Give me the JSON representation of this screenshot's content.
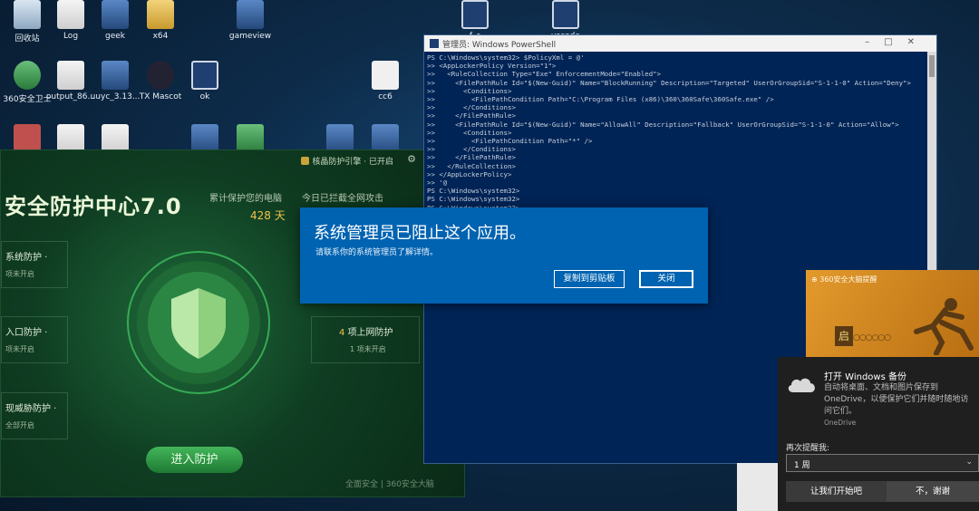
{
  "desktop": {
    "icons": [
      {
        "label": "回收站",
        "icon": "recycle-bin-icon"
      },
      {
        "label": "Log",
        "icon": "file-icon"
      },
      {
        "label": "geek",
        "icon": "app-icon"
      },
      {
        "label": "x64",
        "icon": "folder-icon"
      },
      {
        "label": "gameview",
        "icon": "app-icon"
      },
      {
        "label": "f_s",
        "icon": "window-app-icon"
      },
      {
        "label": "vscode",
        "icon": "window-app-icon"
      },
      {
        "label": "360安全卫士",
        "icon": "shield-plus-icon"
      },
      {
        "label": "output_86...",
        "icon": "file-icon"
      },
      {
        "label": "uuyc_3.13...",
        "icon": "app-icon"
      },
      {
        "label": "TX Mascot",
        "icon": "cat-icon"
      },
      {
        "label": "ok",
        "icon": "window-app-icon"
      },
      {
        "label": "cc6",
        "icon": "cc-app-icon"
      }
    ]
  },
  "security_window": {
    "guard_label": "核晶防护引擎 · 已开启",
    "title": "安全防护中心7.0",
    "stat1_label": "累计保护您的电脑",
    "stat1_value": "428 天",
    "stat2_label": "今日已拦截全网攻击",
    "modules": [
      {
        "name": "系统防护 ·",
        "status": "项未开启"
      },
      {
        "name": "入口防护 ·",
        "status": "项未开启"
      },
      {
        "name": "现威胁防护 ·",
        "status": "全部开启"
      }
    ],
    "right_module": {
      "count": "4",
      "name": "项上网防护",
      "status": "1 项未开启"
    },
    "enter_button": "进入防护",
    "footer": "全面安全  |  360安全大脑"
  },
  "powershell": {
    "title": "管理员: Windows PowerShell",
    "lines": [
      "PS C:\\Windows\\system32> $PolicyXml = @'",
      ">> <AppLockerPolicy Version=\"1\">",
      ">>   <RuleCollection Type=\"Exe\" EnforcementMode=\"Enabled\">",
      ">>     <FilePathRule Id=\"$(New-Guid)\" Name=\"BlockRunning\" Description=\"Targeted\" UserOrGroupSid=\"S-1-1-0\" Action=\"Deny\">",
      ">>       <Conditions>",
      ">>         <FilePathCondition Path=\"C:\\Program Files (x86)\\360\\360Safe\\360Safe.exe\" />",
      ">>       </Conditions>",
      ">>     </FilePathRule>",
      ">>     <FilePathRule Id=\"$(New-Guid)\" Name=\"AllowAll\" Description=\"Fallback\" UserOrGroupSid=\"S-1-1-0\" Action=\"Allow\">",
      ">>       <Conditions>",
      ">>         <FilePathCondition Path=\"*\" />",
      ">>       </Conditions>",
      ">>     </FilePathRule>",
      ">>   </RuleCollection>",
      ">> </AppLockerPolicy>",
      ">> '@",
      "PS C:\\Windows\\system32>",
      "PS C:\\Windows\\system32>",
      "PS C:\\Windows\\system32> "
    ]
  },
  "blocked_dialog": {
    "heading": "系统管理员已阻止这个应用。",
    "message": "请联系你的系统管理员了解详情。",
    "copy_button": "复制到剪贴板",
    "close_button": "关闭"
  },
  "ad_popup": {
    "title": "360安全大脑提醒",
    "box_glyph": "启"
  },
  "onedrive_toast": {
    "title": "打开 Windows 备份",
    "body": "自动将桌面、文档和图片保存到 OneDrive，以便保护它们并随时随地访问它们。",
    "source": "OneDrive",
    "remind_label": "再次提醒我:",
    "remind_value": "1 周",
    "start_button": "让我们开始吧",
    "later_button": "不，谢谢"
  }
}
